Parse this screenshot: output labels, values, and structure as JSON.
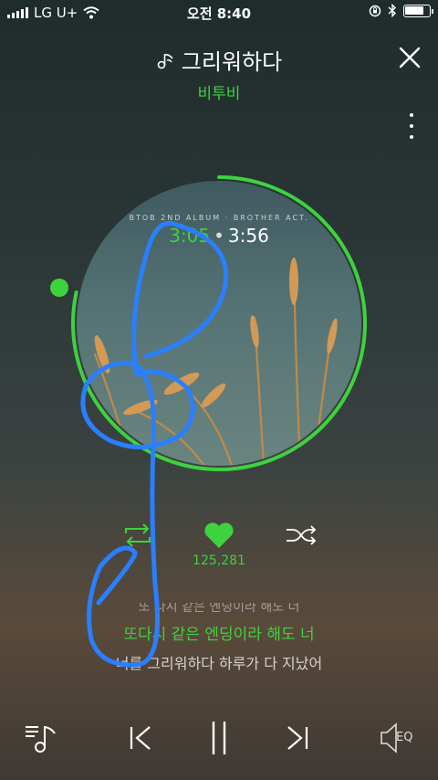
{
  "status_bar": {
    "carrier": "LG U+",
    "time": "오전 8:40",
    "battery_level": 0.8,
    "icons": [
      "signal-icon",
      "wifi-icon",
      "rotation-lock-icon",
      "bluetooth-icon",
      "battery-icon"
    ]
  },
  "header": {
    "title": "그리워하다",
    "artist": "비투비",
    "title_icon": "music-note-icon",
    "close_icon": "close-icon",
    "more_icon": "more-vertical-icon"
  },
  "player": {
    "album_label": "BTOB 2ND ALBUM · BROTHER ACT.",
    "current_time": "3:05",
    "separator": "•",
    "total_time": "3:56",
    "progress": 0.784
  },
  "actions": {
    "repeat_icon": "repeat-icon",
    "like_icon": "heart-icon",
    "like_count": "125,281",
    "shuffle_icon": "shuffle-icon"
  },
  "lyrics": {
    "previous": "또 다시 같은 엔딩이라 해도 너",
    "current": "또다시 같은 엔딩이라 해도 너",
    "next": "너를 그리워하다 하루가 다 지났어"
  },
  "bottom_bar": {
    "playlist_icon": "playlist-icon",
    "prev_icon": "previous-icon",
    "pause_icon": "pause-icon",
    "next_icon": "next-icon",
    "eq_label": "EQ"
  },
  "colors": {
    "accent": "#3ed23e",
    "doodle": "#2a7fff"
  }
}
